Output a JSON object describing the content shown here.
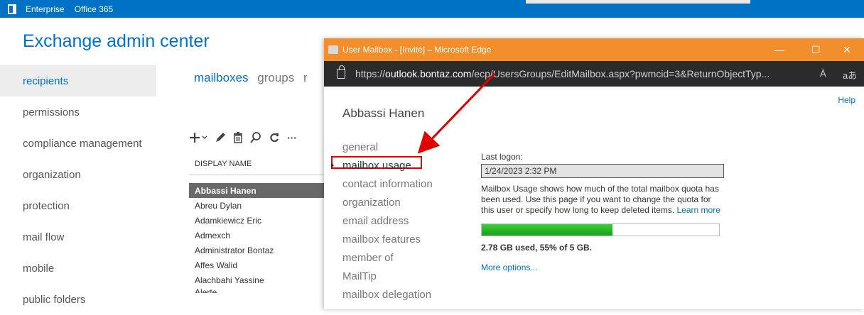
{
  "topbar": {
    "brand1": "Enterprise",
    "brand2": "Office 365"
  },
  "eac": {
    "title": "Exchange admin center"
  },
  "leftnav": {
    "items": [
      {
        "label": "recipients",
        "active": true
      },
      {
        "label": "permissions"
      },
      {
        "label": "compliance management"
      },
      {
        "label": "organization"
      },
      {
        "label": "protection"
      },
      {
        "label": "mail flow"
      },
      {
        "label": "mobile"
      },
      {
        "label": "public folders"
      }
    ]
  },
  "tabs": {
    "mailboxes": "mailboxes",
    "groups": "groups",
    "truncated": "r"
  },
  "toolbar": {
    "icons": [
      "add-icon",
      "dropdown-icon",
      "edit-icon",
      "delete-icon",
      "search-icon",
      "refresh-icon",
      "more-icon"
    ],
    "more_label": "···"
  },
  "table": {
    "header": "DISPLAY NAME",
    "rows": [
      "Abbassi Hanen",
      "Abreu Dylan",
      "Adamkiewicz Eric",
      "Admexch",
      "Administrator Bontaz",
      "Affes Walid",
      "Alachbahi Yassine",
      "Alerte"
    ]
  },
  "popup": {
    "title": "User Mailbox - [Invité] – Microsoft Edge",
    "controls": {
      "minimize": "—",
      "maximize": "☐",
      "close": "✕"
    },
    "url_prefix": "https://",
    "url_domain": "outlook.bontaz.com",
    "url_rest": "/ecp/UsersGroups/EditMailbox.aspx?pwmcid=3&ReturnObjectTyp...",
    "read_aloud": "À",
    "translate": "aあ",
    "help": "Help",
    "user_name": "Abbassi Hanen",
    "subnav": [
      "general",
      "mailbox usage",
      "contact information",
      "organization",
      "email address",
      "mailbox features",
      "member of",
      "MailTip",
      "mailbox delegation"
    ],
    "active_subnav": "mailbox usage",
    "last_logon_label": "Last logon:",
    "last_logon_value": "1/24/2023 2:32 PM",
    "description": "Mailbox Usage shows how much of the total mailbox quota has been used. Use this page if you want to change the quota for this user or specify how long to keep deleted items.",
    "learn_more": "Learn more",
    "usage_fraction": 0.55,
    "usage_text": "2.78 GB used, 55% of 5 GB.",
    "more_options": "More options...",
    "colors": {
      "title_bar": "#f28e2b",
      "url_bar": "#2b2b2b",
      "annotation": "#e00000",
      "bar_fill": "#22b822"
    }
  }
}
